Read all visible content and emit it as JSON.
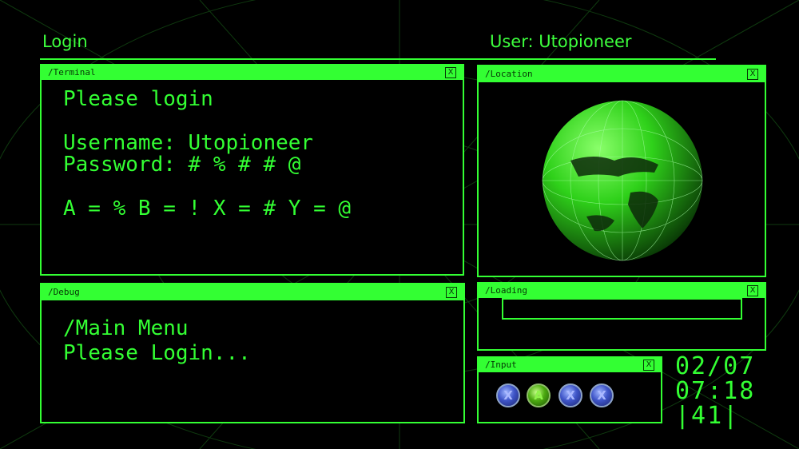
{
  "header": {
    "left_title": "Login",
    "user_label": "User: Utopioneer"
  },
  "terminal": {
    "title": "/Terminal",
    "close": "X",
    "lines": [
      "Please login",
      "",
      "Username: Utopioneer",
      "Password: # % # # @",
      "",
      "A = % B = ! X = # Y = @"
    ]
  },
  "location": {
    "title": "/Location",
    "close": "X",
    "globe": "earth-globe-icon"
  },
  "debug": {
    "title": "/Debug",
    "close": "X",
    "lines": [
      "/Main Menu",
      "Please Login..."
    ]
  },
  "loading": {
    "title": "/Loading",
    "close": "X",
    "progress": 0
  },
  "input": {
    "title": "/Input",
    "close": "X",
    "buttons": [
      {
        "label": "X",
        "color": "#3f55c8"
      },
      {
        "label": "A",
        "color": "#4caa10"
      },
      {
        "label": "X",
        "color": "#3f55c8"
      },
      {
        "label": "X",
        "color": "#3f55c8"
      }
    ]
  },
  "clock": {
    "date": "02/07",
    "time": "07:18",
    "seconds": "|41|"
  },
  "colors": {
    "accent": "#33ff33",
    "background": "#000000",
    "bar_text": "#063806"
  }
}
